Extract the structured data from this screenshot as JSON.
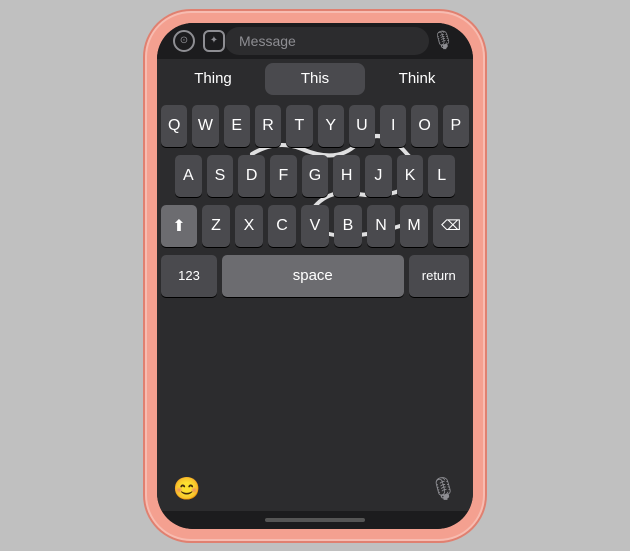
{
  "phone": {
    "colors": {
      "frame": "#f4a090",
      "screen_bg": "#1c1c1e",
      "keyboard_bg": "#2c2c2e",
      "key_bg": "#4a4a4e",
      "key_dark": "#3a3a3e",
      "key_light": "#6c6c70"
    }
  },
  "message_bar": {
    "placeholder": "Message",
    "camera_icon": "⊙",
    "apps_icon": "⊛",
    "mic_icon": "🎙"
  },
  "predictive": {
    "items": [
      {
        "label": "Thing",
        "selected": false
      },
      {
        "label": "This",
        "selected": true
      },
      {
        "label": "Think",
        "selected": false
      }
    ]
  },
  "keyboard": {
    "rows": [
      [
        "Q",
        "W",
        "E",
        "R",
        "T",
        "Y",
        "U",
        "I",
        "O",
        "P"
      ],
      [
        "A",
        "S",
        "D",
        "F",
        "G",
        "H",
        "J",
        "K",
        "L"
      ],
      [
        "Z",
        "X",
        "C",
        "V",
        "B",
        "N",
        "M"
      ]
    ],
    "shift_label": "⬆",
    "delete_label": "⌫",
    "numbers_label": "123",
    "space_label": "space",
    "return_label": "return"
  },
  "bottom_bar": {
    "emoji_icon": "😊",
    "mic_icon": "🎙"
  },
  "home_indicator": {}
}
